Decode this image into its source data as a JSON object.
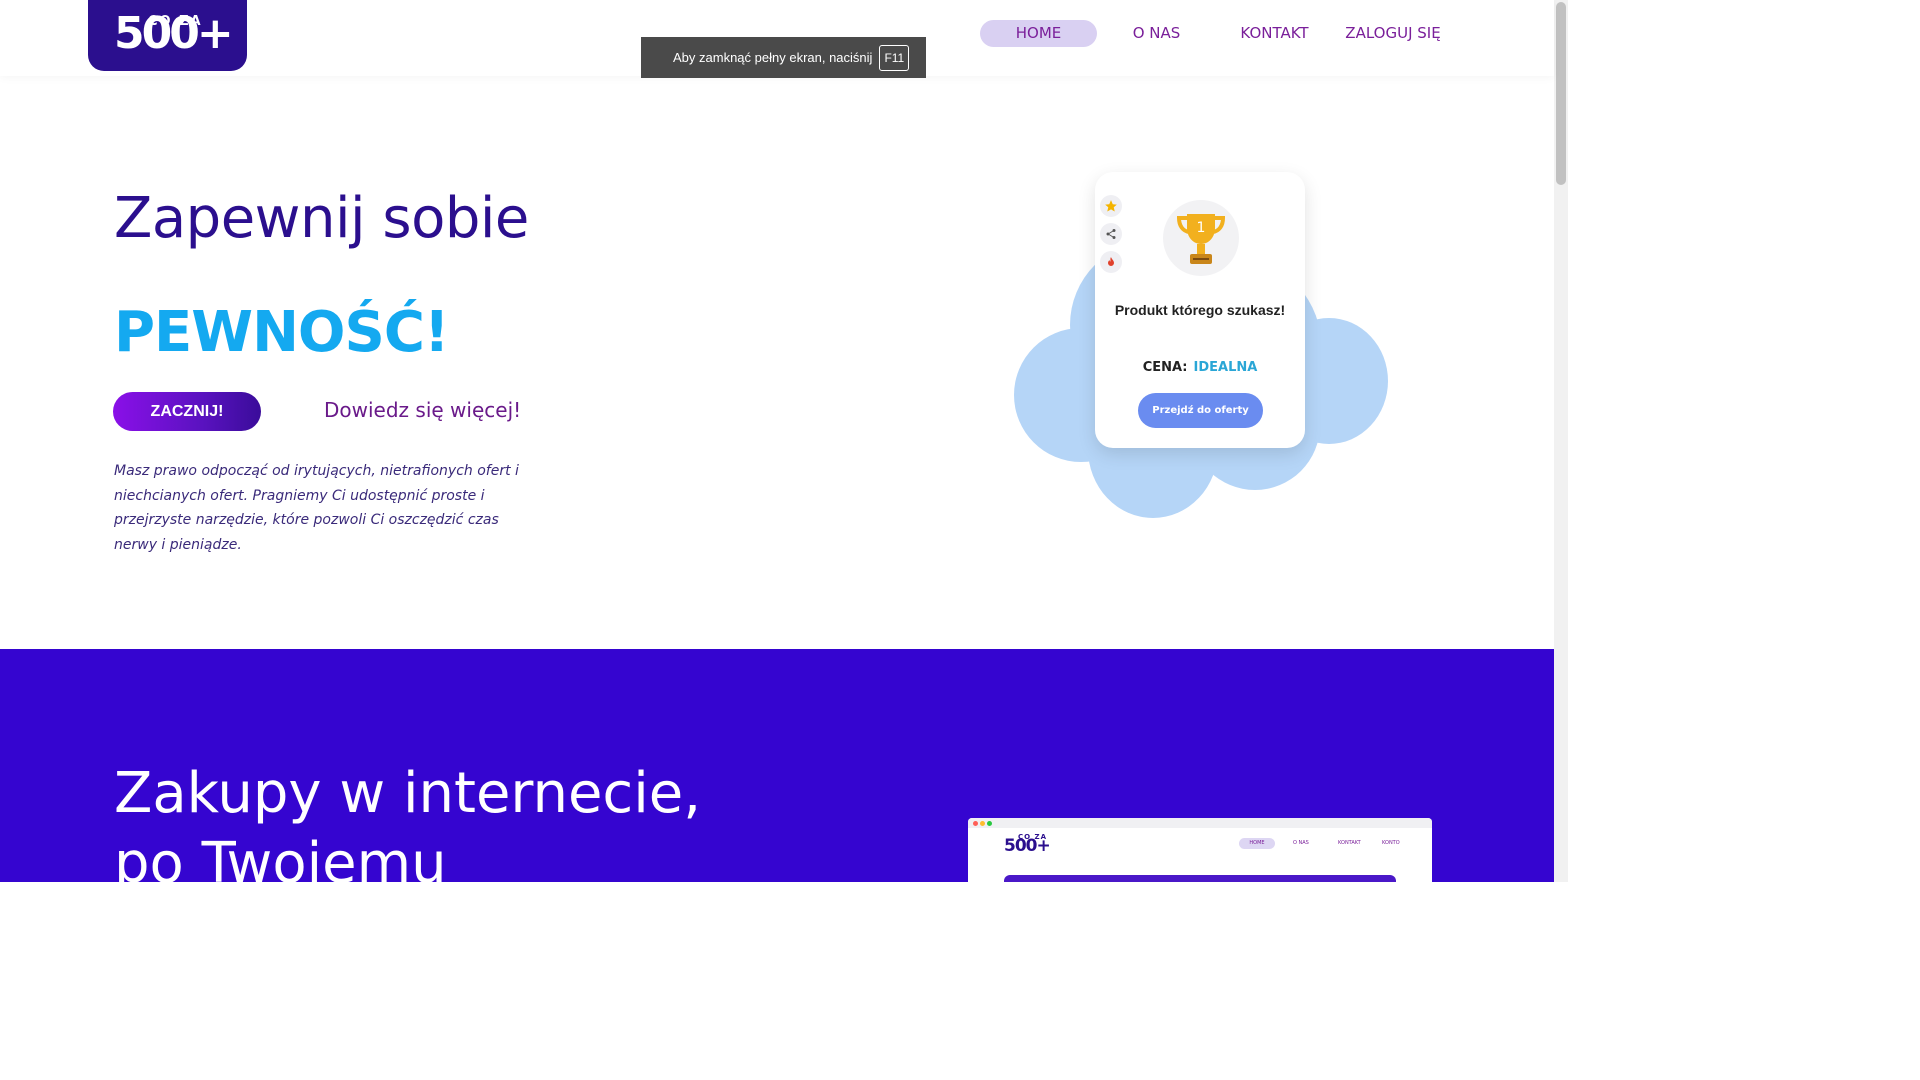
{
  "header": {
    "logo_top": "CO ZA",
    "logo_main": "500+",
    "nav": {
      "home": "HOME",
      "about": "O NAS",
      "contact": "KONTAKT",
      "login": "ZALOGUJ SIĘ"
    }
  },
  "fullscreen_notice": {
    "text": "Aby zamknąć pełny ekran, naciśnij",
    "key": "F11"
  },
  "hero": {
    "title": "Zapewnij sobie",
    "accent": "PEWNOŚĆ!",
    "start_button": "ZACZNIJ!",
    "more_link": "Dowiedz się więcej!",
    "description": "Masz prawo odpocząć od irytujących, nietrafionych ofert i niechcianych ofert. Pragniemy Ci udostępnić proste i przejrzyste narzędzie, które pozwoli Ci oszczędzić czas nerwy i pieniądze."
  },
  "product_card": {
    "trophy_number": "1",
    "title": "Produkt którego szukasz!",
    "price_label": "CENA:",
    "price_value": "IDEALNA",
    "cta": "Przejdź do oferty"
  },
  "section2": {
    "title_line1": "Zakupy w internecie,",
    "title_line2": "po Twojemu"
  },
  "mockup": {
    "logo_top": "CO ZA",
    "logo_main": "500+",
    "nav_home": "HOME",
    "nav_about": "O NAS",
    "nav_contact": "KONTAKT",
    "nav_account": "KONTO"
  },
  "colors": {
    "brand_dark": "#2b0f8e",
    "accent_blue": "#14a9f0",
    "section_purple": "#3505d0",
    "nav_text": "#7a1f9a",
    "cloud": "#b5d5f7"
  }
}
